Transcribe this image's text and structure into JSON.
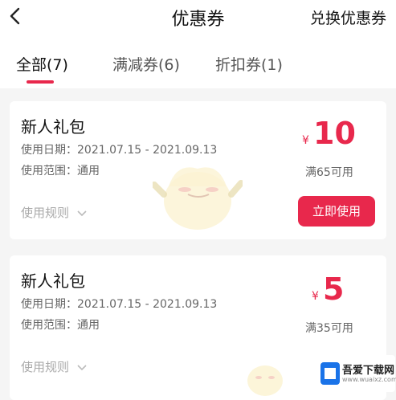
{
  "header": {
    "title": "优惠券",
    "redeem_label": "兑换优惠券"
  },
  "tabs": [
    {
      "label": "全部(7)",
      "active": true
    },
    {
      "label": "满减券(6)",
      "active": false
    },
    {
      "label": "折扣券(1)",
      "active": false
    }
  ],
  "coupons": [
    {
      "name": "新人礼包",
      "date": "使用日期：2021.07.15 - 2021.09.13",
      "scope": "使用范围：通用",
      "rules": "使用规则",
      "currency": "¥",
      "amount": "10",
      "condition": "满65可用",
      "action": "立即使用"
    },
    {
      "name": "新人礼包",
      "date": "使用日期：2021.07.15 - 2021.09.13",
      "scope": "使用范围：通用",
      "rules": "使用规则",
      "currency": "¥",
      "amount": "5",
      "condition": "满35可用"
    }
  ],
  "watermark": {
    "site": "吾爱下载网",
    "url": "www.wuaixz.com"
  },
  "colors": {
    "accent": "#e8284c"
  }
}
